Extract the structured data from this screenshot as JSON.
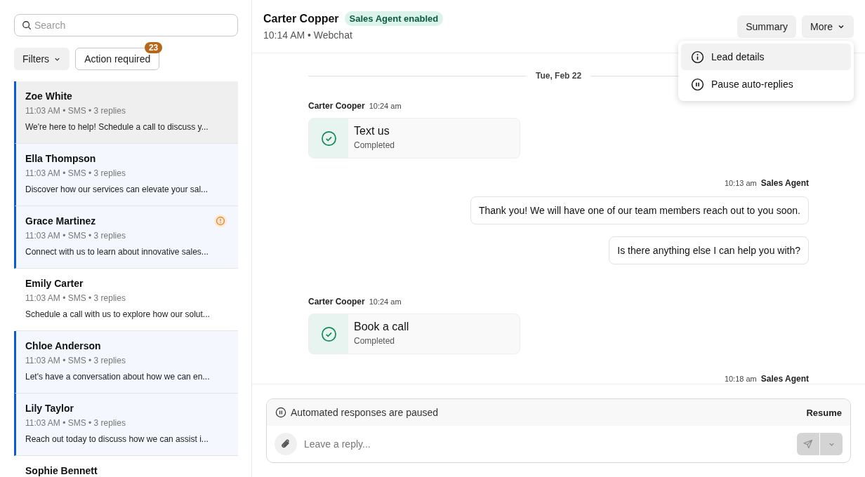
{
  "sidebar": {
    "search": {
      "placeholder": "Search"
    },
    "filters": [
      {
        "kind": "dropdown",
        "label": "Filters"
      },
      {
        "kind": "toggle",
        "label": "Action required",
        "badge": "23"
      }
    ],
    "conversations": [
      {
        "name": "Zoe White",
        "meta": "11:03 AM • SMS • 3 replies",
        "preview": "We're here to help! Schedule a call to discuss y...",
        "selected": true,
        "unread": true,
        "alert": false
      },
      {
        "name": "Ella Thompson",
        "meta": "11:03 AM • SMS • 3 replies",
        "preview": "Discover how our services can elevate your sal...",
        "selected": false,
        "unread": true,
        "alert": false
      },
      {
        "name": "Grace Martinez",
        "meta": "11:03 AM • SMS • 3 replies",
        "preview": "Connect with us to learn about innovative sales...",
        "selected": false,
        "unread": true,
        "alert": true
      },
      {
        "name": "Emily Carter",
        "meta": "11:03 AM • SMS • 3 replies",
        "preview": "Schedule a call with us to explore how our solut...",
        "selected": false,
        "unread": false,
        "alert": false
      },
      {
        "name": "Chloe Anderson",
        "meta": "11:03 AM • SMS • 3 replies",
        "preview": "Let's have a conversation about how we can en...",
        "selected": false,
        "unread": true,
        "alert": false
      },
      {
        "name": "Lily Taylor",
        "meta": "11:03 AM • SMS • 3 replies",
        "preview": "Reach out today to discuss how we can assist i...",
        "selected": false,
        "unread": true,
        "alert": false
      },
      {
        "name": "Sophie Bennett",
        "selected": false,
        "unread": false,
        "alert": false
      }
    ]
  },
  "chat": {
    "contact": "Carter Copper",
    "status_badge": "Sales Agent enabled",
    "subtitle": "10:14 AM • Webchat",
    "buttons": [
      {
        "kind": "plain",
        "label": "Summary"
      },
      {
        "kind": "dropdown",
        "label": "More"
      }
    ],
    "menu": [
      {
        "kind": "info",
        "label": "Lead details",
        "selected": true
      },
      {
        "kind": "pause",
        "label": "Pause auto-replies",
        "selected": false
      }
    ],
    "messages": [
      {
        "kind": "divider",
        "label": "Tue, Feb 22"
      },
      {
        "kind": "task",
        "sender": "Carter Cooper",
        "time": "10:24 am",
        "title": "Text us",
        "status": "Completed"
      },
      {
        "kind": "agent",
        "sender": "Sales Agent",
        "time": "10:13 am",
        "bubbles": [
          "Thank you! We will have one of our team members reach out to you soon.",
          "Is there anything else I can help you with?"
        ]
      },
      {
        "kind": "task",
        "sender": "Carter Cooper",
        "time": "10:24 am",
        "title": "Book a call",
        "status": "Completed"
      },
      {
        "kind": "agent",
        "sender": "Sales Agent",
        "time": "10:18 am"
      }
    ],
    "composer": {
      "notice": "Automated responses are paused",
      "action": "Resume",
      "placeholder": "Leave a reply..."
    }
  }
}
